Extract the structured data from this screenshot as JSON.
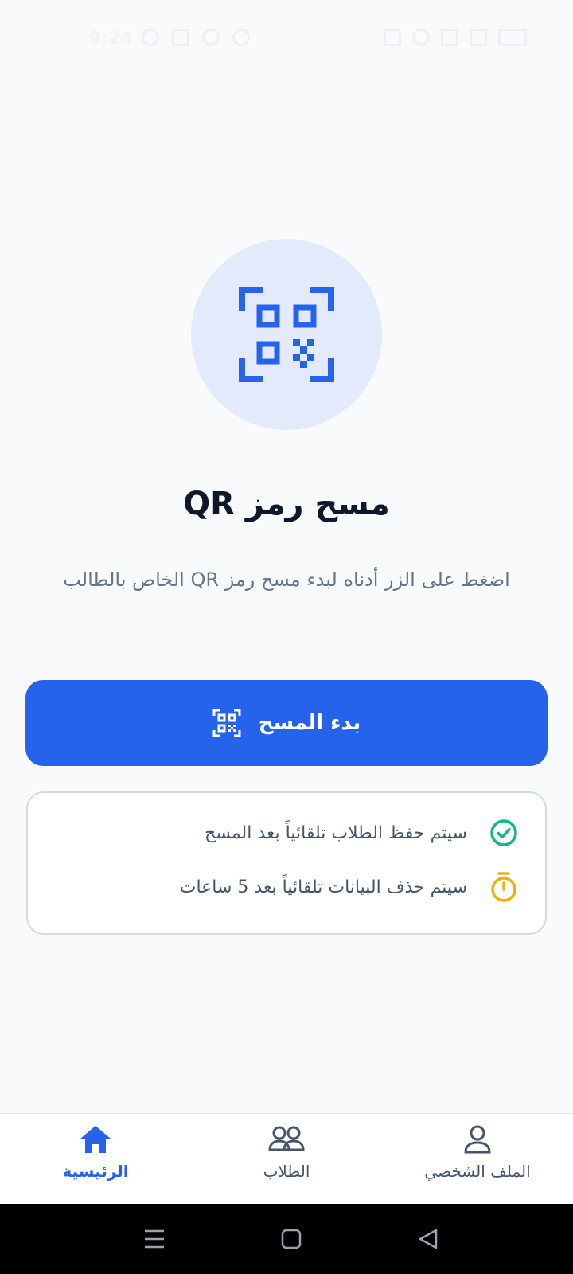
{
  "status_bar": {
    "time": "9:24"
  },
  "hero": {
    "title": "مسح رمز QR",
    "subtitle": "اضغط على الزر أدناه لبدء مسح رمز QR الخاص بالطالب"
  },
  "scan_button": {
    "label": "بدء المسح"
  },
  "info": {
    "items": [
      {
        "text": "سيتم حفظ الطلاب تلقائياً بعد المسح",
        "icon": "check-circle-icon",
        "color": "#10b981"
      },
      {
        "text": "سيتم حذف البيانات تلقائياً بعد 5 ساعات",
        "icon": "timer-icon",
        "color": "#eab308"
      }
    ]
  },
  "bottom_nav": {
    "items": [
      {
        "label": "الرئيسية",
        "icon": "home-icon",
        "active": true
      },
      {
        "label": "الطلاب",
        "icon": "users-icon",
        "active": false
      },
      {
        "label": "الملف الشخصي",
        "icon": "user-icon",
        "active": false
      }
    ]
  },
  "colors": {
    "primary": "#2563eb",
    "background": "#f8fafc",
    "success": "#10b981",
    "warning": "#eab308"
  }
}
